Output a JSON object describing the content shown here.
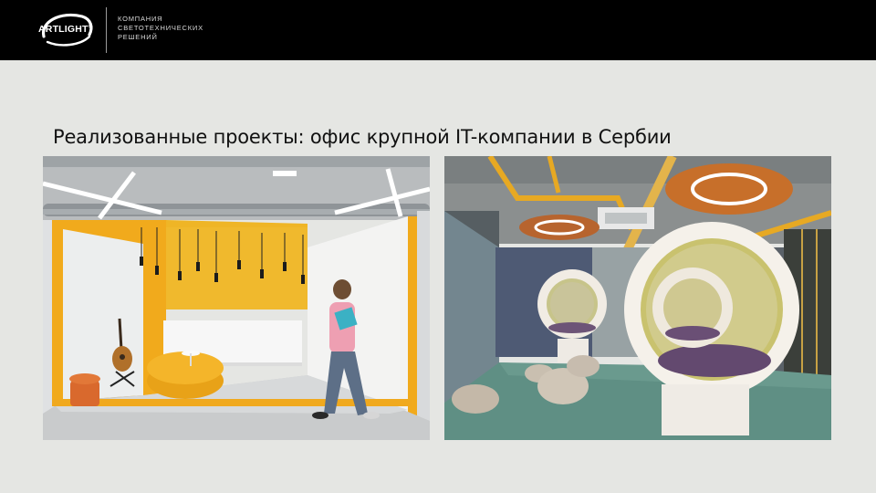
{
  "header": {
    "logo_text": "ARTLIGHT",
    "logo_reg": "®",
    "tagline": [
      "КОМПАНИЯ",
      "СВЕТОТЕХНИЧЕСКИХ",
      "РЕШЕНИЙ"
    ]
  },
  "slide": {
    "title": "Реализованные проекты: офис крупной IT-компании в Сербии"
  },
  "photos": [
    {
      "name": "reception-area-photo"
    },
    {
      "name": "lounge-area-photo"
    }
  ],
  "colors": {
    "header_bg": "#000000",
    "slide_bg": "#e5e6e3",
    "accent_yellow": "#f0a91e",
    "accent_orange": "#d9692d",
    "floor_green": "#5f8f84"
  }
}
